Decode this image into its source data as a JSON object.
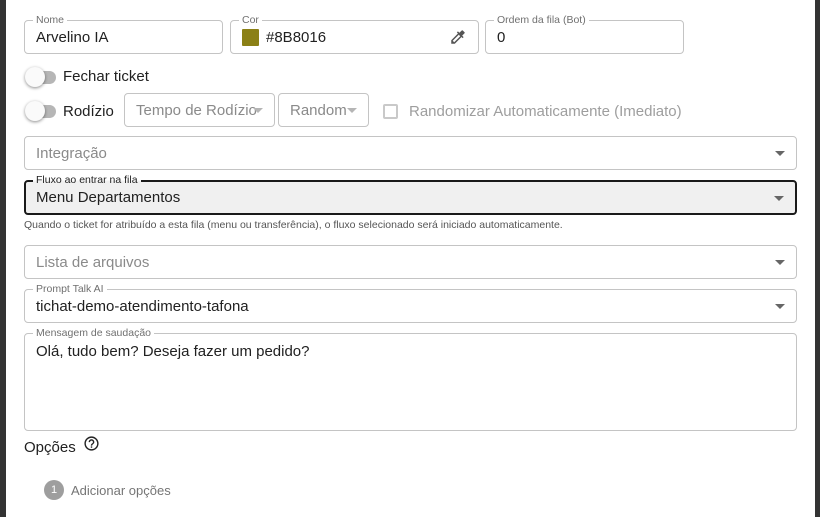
{
  "form": {
    "name": {
      "label": "Nome",
      "value": "Arvelino IA"
    },
    "color": {
      "label": "Cor",
      "value": "#8B8016",
      "swatch": "#8B8016",
      "icon": "eyedropper-icon"
    },
    "order": {
      "label": "Ordem da fila (Bot)",
      "value": "0"
    },
    "close_ticket": {
      "label": "Fechar ticket",
      "checked": false
    },
    "rotation": {
      "label": "Rodízio",
      "checked": false,
      "time_placeholder": "Tempo de Rodízio",
      "mode_placeholder": "Random",
      "auto_random_label": "Randomizar Automaticamente (Imediato)"
    },
    "integration": {
      "placeholder": "Integração"
    },
    "flow": {
      "label": "Fluxo ao entrar na fila",
      "value": "Menu Departamentos",
      "helper": "Quando o ticket for atribuído a esta fila (menu ou transferência), o fluxo selecionado será iniciado automaticamente."
    },
    "files": {
      "placeholder": "Lista de arquivos"
    },
    "prompt": {
      "label": "Prompt Talk AI",
      "value": "tichat-demo-atendimento-tafona"
    },
    "greeting": {
      "label": "Mensagem de saudação",
      "value": "Olá, tudo bem? Deseja fazer um pedido?"
    },
    "options": {
      "title": "Opções",
      "help_icon": "help-circle-icon",
      "step_number": "1",
      "add_label": "Adicionar opções"
    }
  }
}
